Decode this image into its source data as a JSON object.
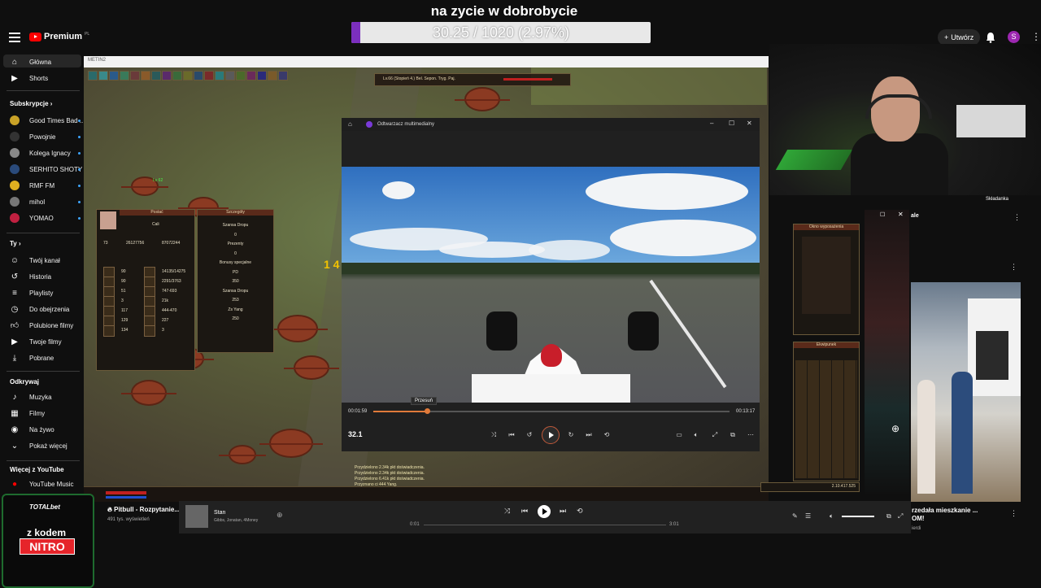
{
  "overlay": {
    "title": "na zycie w dobrobycie",
    "progress_text": "30.25 / 1020 (2.97%)",
    "progress_fraction": 0.0297,
    "bar_color": "#7b2fbe"
  },
  "header": {
    "logo": "Premium",
    "logo_badge": "PL",
    "create_label": "Utwórz",
    "avatar_letter": "S"
  },
  "sidebar": {
    "main": [
      {
        "label": "Główna",
        "icon": "home-icon"
      },
      {
        "label": "Shorts",
        "icon": "shorts-icon"
      }
    ],
    "subs_header": "Subskrypcje",
    "subs": [
      {
        "label": "Good Times Bad ...",
        "color": "#c9a227"
      },
      {
        "label": "Powojnie",
        "color": "#333333"
      },
      {
        "label": "Kolega Ignacy",
        "color": "#888888"
      },
      {
        "label": "SERHITO SHOTY",
        "color": "#2a4a7a"
      },
      {
        "label": "RMF FM",
        "color": "#e0b020"
      },
      {
        "label": "mihol",
        "color": "#777777"
      },
      {
        "label": "YOMAO",
        "color": "#c02040"
      }
    ],
    "you_header": "Ty",
    "you": [
      {
        "label": "Twój kanał",
        "icon": "channel-icon"
      },
      {
        "label": "Historia",
        "icon": "history-icon"
      },
      {
        "label": "Playlisty",
        "icon": "playlist-icon"
      },
      {
        "label": "Do obejrzenia",
        "icon": "clock-icon"
      },
      {
        "label": "Polubione filmy",
        "icon": "like-icon"
      },
      {
        "label": "Twoje filmy",
        "icon": "video-icon"
      },
      {
        "label": "Pobrane",
        "icon": "download-icon"
      }
    ],
    "explore_header": "Odkrywaj",
    "explore": [
      {
        "label": "Muzyka",
        "icon": "music-icon"
      },
      {
        "label": "Filmy",
        "icon": "film-icon"
      },
      {
        "label": "Na żywo",
        "icon": "live-icon"
      },
      {
        "label": "Pokaż więcej",
        "icon": "chevron-down-icon"
      }
    ],
    "more_header": "Więcej z YouTube",
    "more": [
      {
        "label": "YouTube Music",
        "icon": "yt-music-icon"
      }
    ]
  },
  "game": {
    "window_title": "METIN2",
    "target_text": "Lv.66 (Stopień 4.) Bel. Sepon. Tryg. Paj.",
    "char_panel_title": "Postać",
    "char_name": "Cali",
    "char_level": "73",
    "char_exp": "26127756",
    "char_exp_max": "87072244",
    "stats_left": [
      "90",
      "90",
      "51",
      "3",
      "117",
      "129",
      "134"
    ],
    "stats_right": [
      "14135/14275",
      "2291/3763",
      "747-693",
      "21k",
      "444-470",
      "227",
      "3"
    ],
    "details_title": "Szczegóły",
    "details_rows": [
      "Szansa Dropu",
      "0",
      "Prezenty",
      "0",
      "Bonusy specjalne",
      "PD",
      "350",
      "Szansa Dropu",
      "253",
      "Zs Yang",
      "250"
    ],
    "equip_title": "Okno wyposażenia",
    "inv_title": "Ekwipunek",
    "chat_lines": [
      "Przydzielono 2.34k pkt doświadczenia.",
      "Przydzielono 2.34k pkt doświadczenia.",
      "Przydzielono 6.41k pkt doświadczenia.",
      "Przyznano ci 444 Yang."
    ],
    "gold": "2.10.417.525",
    "floating_number": "1 4",
    "monster_tag": "Lv 62"
  },
  "player": {
    "title": "Odtwarzacz multimedialny",
    "time_current": "00:01:59",
    "time_total": "00:13:17",
    "progress_fraction": 0.15,
    "tooltip": "Przesuń",
    "rate": "32.1",
    "accent": "#e07a3a"
  },
  "right": {
    "channel_label": "ale",
    "skladanka": "Składanka",
    "video_title_1": "rzedała mieszkanie ...",
    "video_title_2": "OM!",
    "video_sub": "ierdi"
  },
  "music": {
    "track_title": "Stan",
    "track_artists": "Gibbs, Jonatan, 4Money",
    "time_current": "0:01",
    "time_total": "3:01",
    "progress_fraction": 0.005
  },
  "pitbull": {
    "title": "Pitbull - Rozpytanie...",
    "views": "491 tys. wyświetleń"
  },
  "totalbet": {
    "logo": "TOTALbet",
    "line1": "z kodem",
    "line2": "NITRO"
  }
}
